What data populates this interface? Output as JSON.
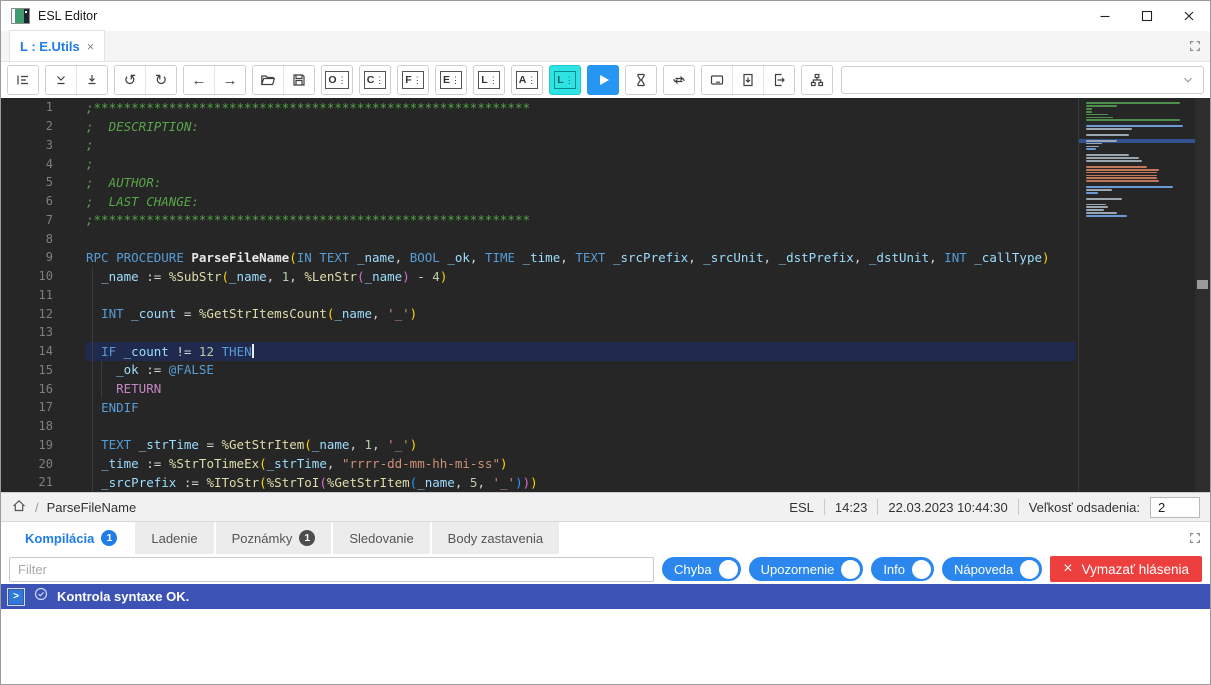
{
  "window": {
    "title": "ESL Editor"
  },
  "tab_bar": {
    "active_tab": "L : E.Utils",
    "close_glyph": "×"
  },
  "toolbar": {
    "letter_buttons": [
      "O",
      "C",
      "F",
      "E",
      "L",
      "A"
    ],
    "active_letter": "L",
    "dropdown_value": ""
  },
  "editor": {
    "current_line_num": 14,
    "lines": [
      {
        "num": 1,
        "tokens": [
          [
            "c",
            ";**********************************************************"
          ]
        ]
      },
      {
        "num": 2,
        "tokens": [
          [
            "c",
            ";  DESCRIPTION:"
          ]
        ]
      },
      {
        "num": 3,
        "tokens": [
          [
            "c",
            ";"
          ]
        ]
      },
      {
        "num": 4,
        "tokens": [
          [
            "c",
            ";"
          ]
        ]
      },
      {
        "num": 5,
        "tokens": [
          [
            "c",
            ";  AUTHOR:"
          ]
        ]
      },
      {
        "num": 6,
        "tokens": [
          [
            "c",
            ";  LAST CHANGE:"
          ]
        ]
      },
      {
        "num": 7,
        "tokens": [
          [
            "c",
            ";**********************************************************"
          ]
        ]
      },
      {
        "num": 8,
        "tokens": []
      },
      {
        "num": 9,
        "tokens": [
          [
            "k",
            "RPC"
          ],
          [
            "o",
            " "
          ],
          [
            "k",
            "PROCEDURE"
          ],
          [
            "o",
            " "
          ],
          [
            "fn",
            "ParseFileName"
          ],
          [
            "p1",
            "("
          ],
          [
            "k",
            "IN"
          ],
          [
            "o",
            " "
          ],
          [
            "k",
            "TEXT"
          ],
          [
            "o",
            " "
          ],
          [
            "v",
            "_name"
          ],
          [
            "o",
            ", "
          ],
          [
            "k",
            "BOOL"
          ],
          [
            "o",
            " "
          ],
          [
            "v",
            "_ok"
          ],
          [
            "o",
            ", "
          ],
          [
            "k",
            "TIME"
          ],
          [
            "o",
            " "
          ],
          [
            "v",
            "_time"
          ],
          [
            "o",
            ", "
          ],
          [
            "k",
            "TEXT"
          ],
          [
            "o",
            " "
          ],
          [
            "v",
            "_srcPrefix"
          ],
          [
            "o",
            ", "
          ],
          [
            "v",
            "_srcUnit"
          ],
          [
            "o",
            ", "
          ],
          [
            "v",
            "_dstPrefix"
          ],
          [
            "o",
            ", "
          ],
          [
            "v",
            "_dstUnit"
          ],
          [
            "o",
            ", "
          ],
          [
            "k",
            "INT"
          ],
          [
            "o",
            " "
          ],
          [
            "v",
            "_callType"
          ],
          [
            "p1",
            ")"
          ]
        ]
      },
      {
        "num": 10,
        "tokens": [
          [
            "o",
            "  "
          ],
          [
            "v",
            "_name"
          ],
          [
            "o",
            " := "
          ],
          [
            "f",
            "%SubStr"
          ],
          [
            "p1",
            "("
          ],
          [
            "v",
            "_name"
          ],
          [
            "o",
            ", "
          ],
          [
            "n",
            "1"
          ],
          [
            "o",
            ", "
          ],
          [
            "f",
            "%LenStr"
          ],
          [
            "p2",
            "("
          ],
          [
            "v",
            "_name"
          ],
          [
            "p2",
            ")"
          ],
          [
            "o",
            " - "
          ],
          [
            "n",
            "4"
          ],
          [
            "p1",
            ")"
          ]
        ]
      },
      {
        "num": 11,
        "tokens": []
      },
      {
        "num": 12,
        "tokens": [
          [
            "o",
            "  "
          ],
          [
            "k",
            "INT"
          ],
          [
            "o",
            " "
          ],
          [
            "v",
            "_count"
          ],
          [
            "o",
            " = "
          ],
          [
            "f",
            "%GetStrItemsCount"
          ],
          [
            "p1",
            "("
          ],
          [
            "v",
            "_name"
          ],
          [
            "o",
            ", "
          ],
          [
            "s",
            "'_'"
          ],
          [
            "p1",
            ")"
          ]
        ]
      },
      {
        "num": 13,
        "tokens": []
      },
      {
        "num": 14,
        "tokens": [
          [
            "o",
            "  "
          ],
          [
            "k",
            "IF"
          ],
          [
            "o",
            " "
          ],
          [
            "v",
            "_count"
          ],
          [
            "o",
            " != "
          ],
          [
            "n",
            "12"
          ],
          [
            "o",
            " "
          ],
          [
            "k",
            "THEN"
          ]
        ]
      },
      {
        "num": 15,
        "tokens": [
          [
            "o",
            "    "
          ],
          [
            "v",
            "_ok"
          ],
          [
            "o",
            " := "
          ],
          [
            "k",
            "@FALSE"
          ]
        ]
      },
      {
        "num": 16,
        "tokens": [
          [
            "o",
            "    "
          ],
          [
            "ret",
            "RETURN"
          ]
        ]
      },
      {
        "num": 17,
        "tokens": [
          [
            "o",
            "  "
          ],
          [
            "k",
            "ENDIF"
          ]
        ]
      },
      {
        "num": 18,
        "tokens": []
      },
      {
        "num": 19,
        "tokens": [
          [
            "o",
            "  "
          ],
          [
            "k",
            "TEXT"
          ],
          [
            "o",
            " "
          ],
          [
            "v",
            "_strTime"
          ],
          [
            "o",
            " = "
          ],
          [
            "f",
            "%GetStrItem"
          ],
          [
            "p1",
            "("
          ],
          [
            "v",
            "_name"
          ],
          [
            "o",
            ", "
          ],
          [
            "n",
            "1"
          ],
          [
            "o",
            ", "
          ],
          [
            "s",
            "'_'"
          ],
          [
            "p1",
            ")"
          ]
        ]
      },
      {
        "num": 20,
        "tokens": [
          [
            "o",
            "  "
          ],
          [
            "v",
            "_time"
          ],
          [
            "o",
            " := "
          ],
          [
            "f",
            "%StrToTimeEx"
          ],
          [
            "p1",
            "("
          ],
          [
            "v",
            "_strTime"
          ],
          [
            "o",
            ", "
          ],
          [
            "s",
            "\"rrrr-dd-mm-hh-mi-ss\""
          ],
          [
            "p1",
            ")"
          ]
        ]
      },
      {
        "num": 21,
        "tokens": [
          [
            "o",
            "  "
          ],
          [
            "v",
            "_srcPrefix"
          ],
          [
            "o",
            " := "
          ],
          [
            "f",
            "%IToStr"
          ],
          [
            "p1",
            "("
          ],
          [
            "f",
            "%StrToI"
          ],
          [
            "p2",
            "("
          ],
          [
            "f",
            "%GetStrItem"
          ],
          [
            "p3",
            "("
          ],
          [
            "v",
            "_name"
          ],
          [
            "o",
            ", "
          ],
          [
            "n",
            "5"
          ],
          [
            "o",
            ", "
          ],
          [
            "s",
            "'_'"
          ],
          [
            "p3",
            ")"
          ],
          [
            "p2",
            ")"
          ],
          [
            "p1",
            ")"
          ]
        ]
      }
    ]
  },
  "status_bar": {
    "breadcrumb": "ParseFileName",
    "language": "ESL",
    "cursor_position": "14:23",
    "timestamp": "22.03.2023 10:44:30",
    "indent_label": "Veľkosť odsadenia:",
    "indent_size": "2"
  },
  "bottom_panel": {
    "tabs": [
      {
        "label": "Kompilácia",
        "badge": "1"
      },
      {
        "label": "Ladenie"
      },
      {
        "label": "Poznámky",
        "badge": "1"
      },
      {
        "label": "Sledovanie"
      },
      {
        "label": "Body zastavenia"
      }
    ],
    "active_tab": "Kompilácia",
    "filter_placeholder": "Filter",
    "toggles": [
      "Chyba",
      "Upozornenie",
      "Info",
      "Nápoveda"
    ],
    "clear_button_label": "Vymazať hlásenia",
    "clear_button_glyph": "×",
    "messages": [
      {
        "text": "Kontrola syntaxe OK.",
        "selected": true
      }
    ]
  },
  "colors": {
    "accent_blue": "#1f7ce8",
    "toggle_blue": "#2b87ee",
    "clear_red": "#ee3f3f",
    "selected_row_blue": "#3c52b4",
    "editor_bg": "#262626",
    "current_line_bg": "#20294e",
    "active_tool_cyan": "#2ee3e3",
    "play_blue": "#2795f2",
    "comment_green": "#57a64a"
  }
}
